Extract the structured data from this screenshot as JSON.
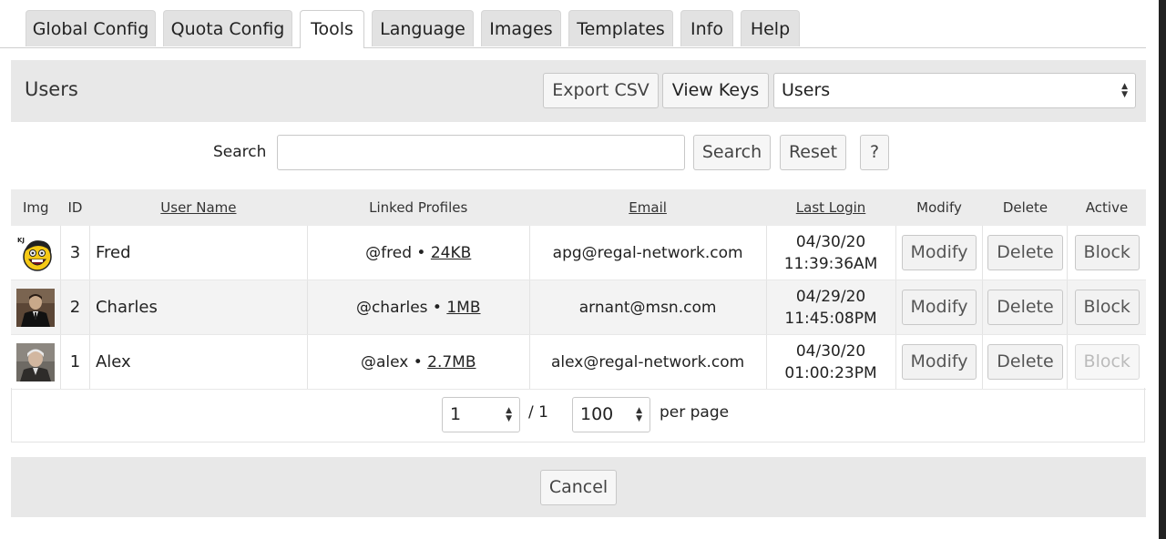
{
  "tabs": [
    {
      "label": "Global Config"
    },
    {
      "label": "Quota Config"
    },
    {
      "label": "Tools"
    },
    {
      "label": "Language"
    },
    {
      "label": "Images"
    },
    {
      "label": "Templates"
    },
    {
      "label": "Info"
    },
    {
      "label": "Help"
    }
  ],
  "active_tab": "Tools",
  "header": {
    "title": "Users",
    "export_csv_label": "Export CSV",
    "view_keys_label": "View Keys",
    "view_select_value": "Users"
  },
  "search": {
    "label": "Search",
    "value": "",
    "placeholder": "",
    "search_button": "Search",
    "reset_button": "Reset",
    "help_button": "?"
  },
  "table": {
    "columns": {
      "img": "Img",
      "id": "ID",
      "user_name": "User Name",
      "linked_profiles": "Linked Profiles",
      "email": "Email",
      "last_login": "Last Login",
      "modify": "Modify",
      "delete": "Delete",
      "active": "Active"
    },
    "rows": [
      {
        "avatar": "rage-face-avatar",
        "id": "3",
        "name": "Fred",
        "profile": "@fred •",
        "size": "24KB",
        "email": "apg@regal-network.com",
        "login_date": "04/30/20",
        "login_time": "11:39:36AM",
        "modify": "Modify",
        "delete": "Delete",
        "active": "Block",
        "active_enabled": true
      },
      {
        "avatar": "man-in-suit-avatar",
        "id": "2",
        "name": "Charles",
        "profile": "@charles •",
        "size": "1MB",
        "email": "arnant@msn.com",
        "login_date": "04/29/20",
        "login_time": "11:45:08PM",
        "modify": "Modify",
        "delete": "Delete",
        "active": "Block",
        "active_enabled": true
      },
      {
        "avatar": "gray-hair-man-avatar",
        "id": "1",
        "name": "Alex",
        "profile": "@alex •",
        "size": "2.7MB",
        "email": "alex@regal-network.com",
        "login_date": "04/30/20",
        "login_time": "01:00:23PM",
        "modify": "Modify",
        "delete": "Delete",
        "active": "Block",
        "active_enabled": false
      }
    ]
  },
  "pagination": {
    "page": "1",
    "of_pages": "/ 1",
    "per_page_value": "100",
    "per_page_label": "per page"
  },
  "footer": {
    "cancel_label": "Cancel"
  }
}
